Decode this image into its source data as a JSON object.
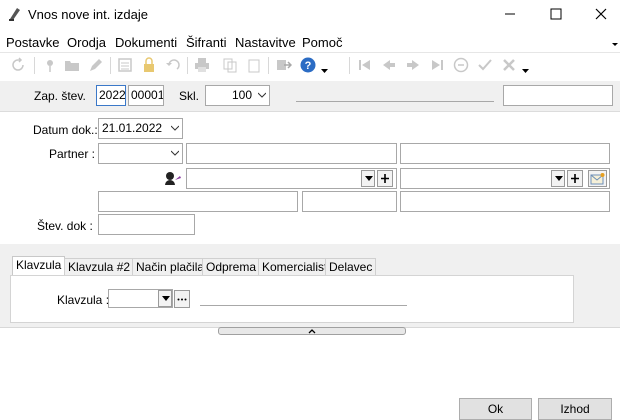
{
  "window": {
    "title": "Vnos nove int. izdaje"
  },
  "menu": {
    "items": [
      "Postavke",
      "Orodja",
      "Dokumenti",
      "Šifranti",
      "Nastavitve",
      "Pomoč"
    ]
  },
  "header": {
    "zap_label": "Zap. štev.",
    "zap_year": "2022",
    "zap_number": "00001",
    "skl_label": "Skl.",
    "skl_value": "100"
  },
  "form": {
    "datum_label": "Datum dok.:",
    "datum_value": "21.01.2022",
    "partner_label": "Partner :",
    "stev_label": "Štev. dok :"
  },
  "tabs": [
    {
      "label": "Klavzula",
      "active": true
    },
    {
      "label": "Klavzula #2",
      "active": false
    },
    {
      "label": "Način plačila",
      "active": false
    },
    {
      "label": "Odprema",
      "active": false
    },
    {
      "label": "Komercialist",
      "active": false
    },
    {
      "label": "Delavec",
      "active": false
    }
  ],
  "tab_content": {
    "klavzula_label": "Klavzula :"
  },
  "footer": {
    "ok_label": "Ok",
    "izhod_label": "Izhod"
  },
  "colors": {
    "icon_disabled": "#c8c8c8",
    "help_blue": "#2b6cc4",
    "panel_bg": "#f0f0f0"
  }
}
